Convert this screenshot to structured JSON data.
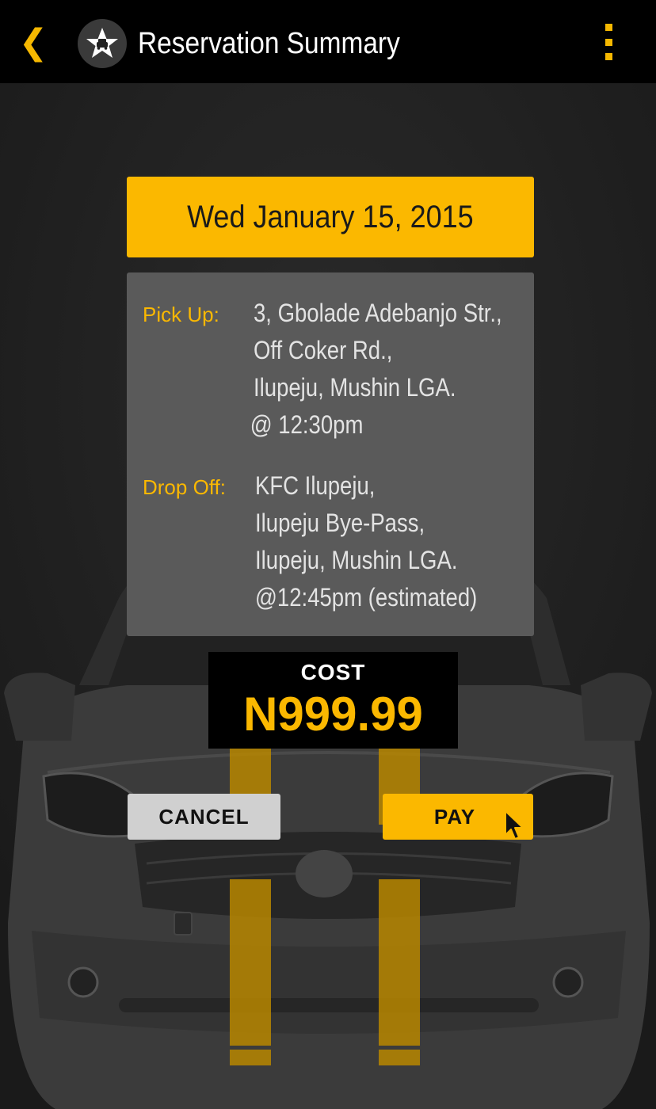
{
  "header": {
    "back_glyph": "❮",
    "title": "Reservation Summary"
  },
  "reservation": {
    "date": "Wed January 15, 2015",
    "pickup": {
      "label": "Pick Up:",
      "lines": [
        "3, Gbolade Adebanjo Str.,",
        "Off Coker Rd.,",
        "Ilupeju, Mushin LGA.",
        "@ 12:30pm"
      ]
    },
    "dropoff": {
      "label": "Drop Off:",
      "lines": [
        "KFC Ilupeju,",
        "Ilupeju Bye-Pass,",
        "Ilupeju, Mushin LGA.",
        "@12:45pm (estimated)"
      ]
    }
  },
  "cost": {
    "label": "COST",
    "value": "N999.99"
  },
  "actions": {
    "cancel_label": "CANCEL",
    "pay_label": "PAY"
  },
  "icons": {
    "back": "chevron-left-icon",
    "logo": "star-taxi-logo",
    "menu": "more-vertical-icon",
    "cursor": "mouse-pointer-icon"
  },
  "colors": {
    "accent": "#fbb800",
    "header_bg": "#000000",
    "card_bg": "#5a5a5a",
    "page_bg": "#1c1c1c"
  }
}
